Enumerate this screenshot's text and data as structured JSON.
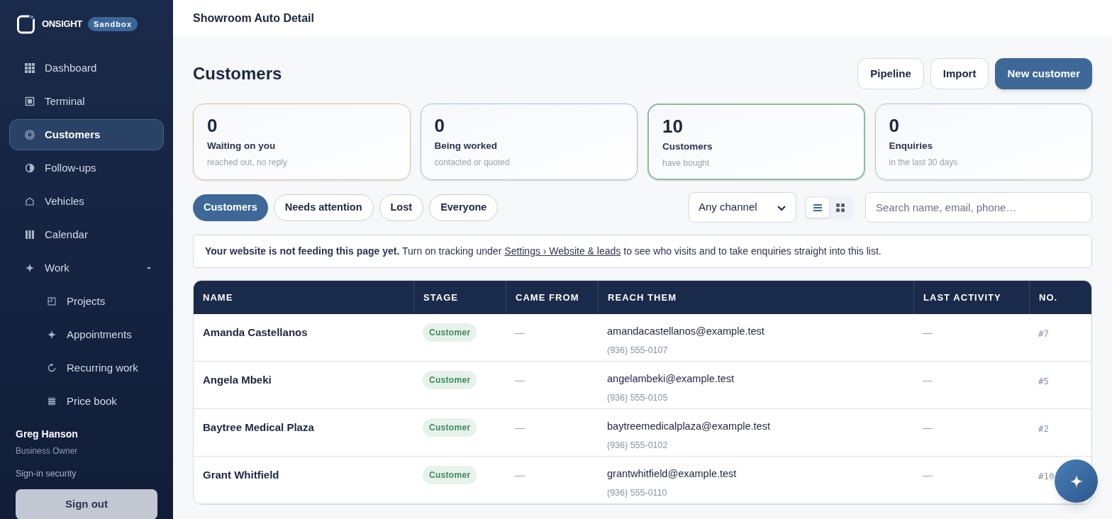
{
  "brand": {
    "name": "ONSIGHT",
    "badge": "Sandbox"
  },
  "sidebar": {
    "items": [
      {
        "label": "Dashboard",
        "selected": false
      },
      {
        "label": "Terminal",
        "selected": false
      },
      {
        "label": "Customers",
        "selected": true
      },
      {
        "label": "Follow-ups",
        "selected": false
      },
      {
        "label": "Vehicles",
        "selected": false
      },
      {
        "label": "Calendar",
        "selected": false
      },
      {
        "label": "Work",
        "selected": false,
        "expanded": true,
        "children": [
          {
            "label": "Projects",
            "selected": false
          },
          {
            "label": "Appointments",
            "selected": false
          },
          {
            "label": "Recurring work",
            "selected": false
          },
          {
            "label": "Price book",
            "selected": false
          }
        ]
      }
    ]
  },
  "user": {
    "name": "Greg Hanson",
    "role": "Business Owner",
    "security_link": "Sign-in security",
    "sign_out": "Sign out"
  },
  "header": {
    "title": "Showroom Auto Detail"
  },
  "page": {
    "title": "Customers",
    "buttons": [
      {
        "label": "Pipeline",
        "kind": "outline"
      },
      {
        "label": "Import",
        "kind": "outline"
      },
      {
        "label": "New customer",
        "kind": "primary"
      }
    ]
  },
  "stats": [
    {
      "value": "0",
      "label": "Waiting on you",
      "sub": "reached out, no reply",
      "color": "#d9c3a3",
      "selected": false
    },
    {
      "value": "0",
      "label": "Being worked",
      "sub": "contacted or quoted",
      "color": "#a9bfdc",
      "selected": false
    },
    {
      "value": "10",
      "label": "Customers",
      "sub": "have bought",
      "color": "#8dbb9f",
      "selected": true
    },
    {
      "value": "0",
      "label": "Enquiries",
      "sub": "in the last 30 days",
      "color": "#b9c2d2",
      "selected": false
    }
  ],
  "filters": [
    {
      "label": "Customers",
      "selected": true
    },
    {
      "label": "Needs attention",
      "selected": false
    },
    {
      "label": "Lost",
      "selected": false
    },
    {
      "label": "Everyone",
      "selected": false
    }
  ],
  "channel_select": {
    "value": "Any channel"
  },
  "view_toggle": [
    {
      "kind": "list",
      "selected": true
    },
    {
      "kind": "grid",
      "selected": false
    }
  ],
  "search": {
    "placeholder": "Search name, email, phone…"
  },
  "notice": {
    "text": "**Your website is not feeding this page yet.** Turn on tracking under",
    "link": "Settings › Website & leads",
    "text_after": "to see who visits and to take enquiries straight into this list."
  },
  "table": {
    "columns": [
      "NAME",
      "STAGE",
      "CAME FROM",
      "REACH THEM",
      "LAST ACTIVITY",
      "NO."
    ],
    "rows": [
      {
        "name": "Amanda Castellanos",
        "stage": "Customer",
        "came_from": "—",
        "email": "amandacastellanos@example.test",
        "phone": "(936) 555-0107",
        "last_activity": "—",
        "no": "#7"
      },
      {
        "name": "Angela Mbeki",
        "stage": "Customer",
        "came_from": "—",
        "email": "angelambeki@example.test",
        "phone": "(936) 555-0105",
        "last_activity": "—",
        "no": "#5"
      },
      {
        "name": "Baytree Medical Plaza",
        "stage": "Customer",
        "came_from": "—",
        "email": "baytreemedicalplaza@example.test",
        "phone": "(936) 555-0102",
        "last_activity": "—",
        "no": "#2"
      },
      {
        "name": "Grant Whitfield",
        "stage": "Customer",
        "came_from": "—",
        "email": "grantwhitfield@example.test",
        "phone": "(936) 555-0110",
        "last_activity": "—",
        "no": "#10"
      }
    ]
  }
}
